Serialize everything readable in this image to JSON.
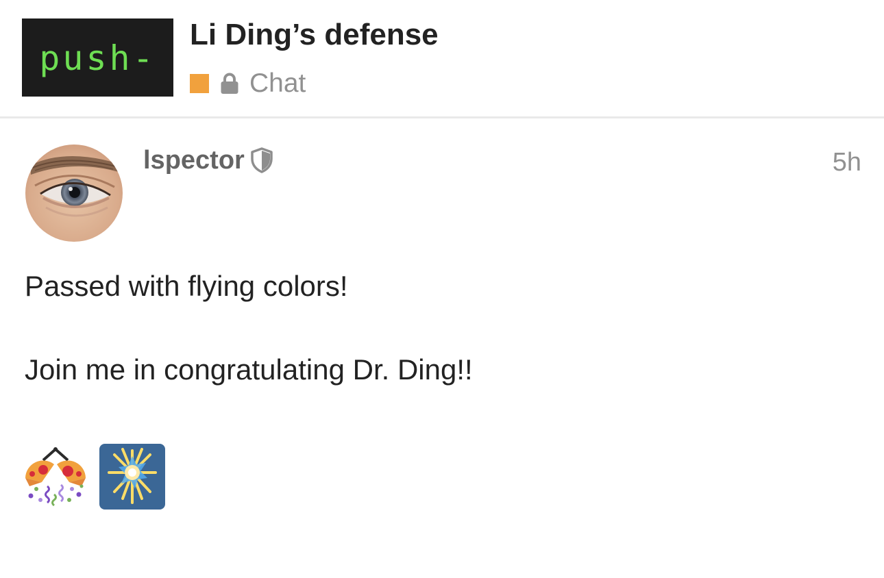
{
  "header": {
    "logo_text": "push-",
    "topic_title": "Li Ding’s defense",
    "category": {
      "name": "Chat",
      "color": "#f1a13d",
      "icon": "lock-icon"
    }
  },
  "post": {
    "avatar_icon": "avatar-eye",
    "username": "lspector",
    "user_badge_icon": "shield-icon",
    "time": "5h",
    "paragraphs": [
      "Passed with flying colors!",
      "Join me in congratulating Dr. Ding!!"
    ],
    "emojis": [
      {
        "name": "confetti-ball-emoji",
        "alt": "🎊"
      },
      {
        "name": "sparkler-emoji",
        "alt": "🎇"
      }
    ]
  },
  "colors": {
    "logo_bg": "#1c1c1c",
    "logo_text": "#6ede53",
    "title_text": "#222222",
    "muted_text": "#919191",
    "username_text": "#646464",
    "divider": "#e9e9e9"
  }
}
